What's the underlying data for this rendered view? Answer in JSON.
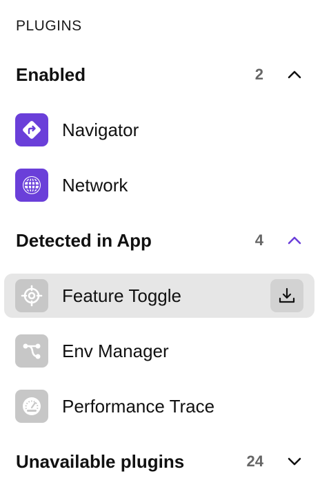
{
  "panel": {
    "title": "PLUGINS"
  },
  "sections": {
    "enabled": {
      "title": "Enabled",
      "count": "2",
      "expanded": true,
      "chevron_color": "#111111",
      "items": [
        {
          "label": "Navigator",
          "icon": "navigation-arrow-icon",
          "icon_bg": "#6a3fd9"
        },
        {
          "label": "Network",
          "icon": "globe-icon",
          "icon_bg": "#6a3fd9"
        }
      ]
    },
    "detected": {
      "title": "Detected in App",
      "count": "4",
      "expanded": true,
      "chevron_color": "#6a3fd9",
      "items": [
        {
          "label": "Feature Toggle",
          "icon": "target-icon",
          "icon_bg": "#c7c7c7",
          "selected": true,
          "action": "download-icon"
        },
        {
          "label": "Env Manager",
          "icon": "branch-icon",
          "icon_bg": "#c7c7c7"
        },
        {
          "label": "Performance Trace",
          "icon": "gauge-icon",
          "icon_bg": "#c7c7c7"
        }
      ]
    },
    "unavailable": {
      "title": "Unavailable plugins",
      "count": "24",
      "expanded": false,
      "chevron_color": "#111111"
    }
  }
}
